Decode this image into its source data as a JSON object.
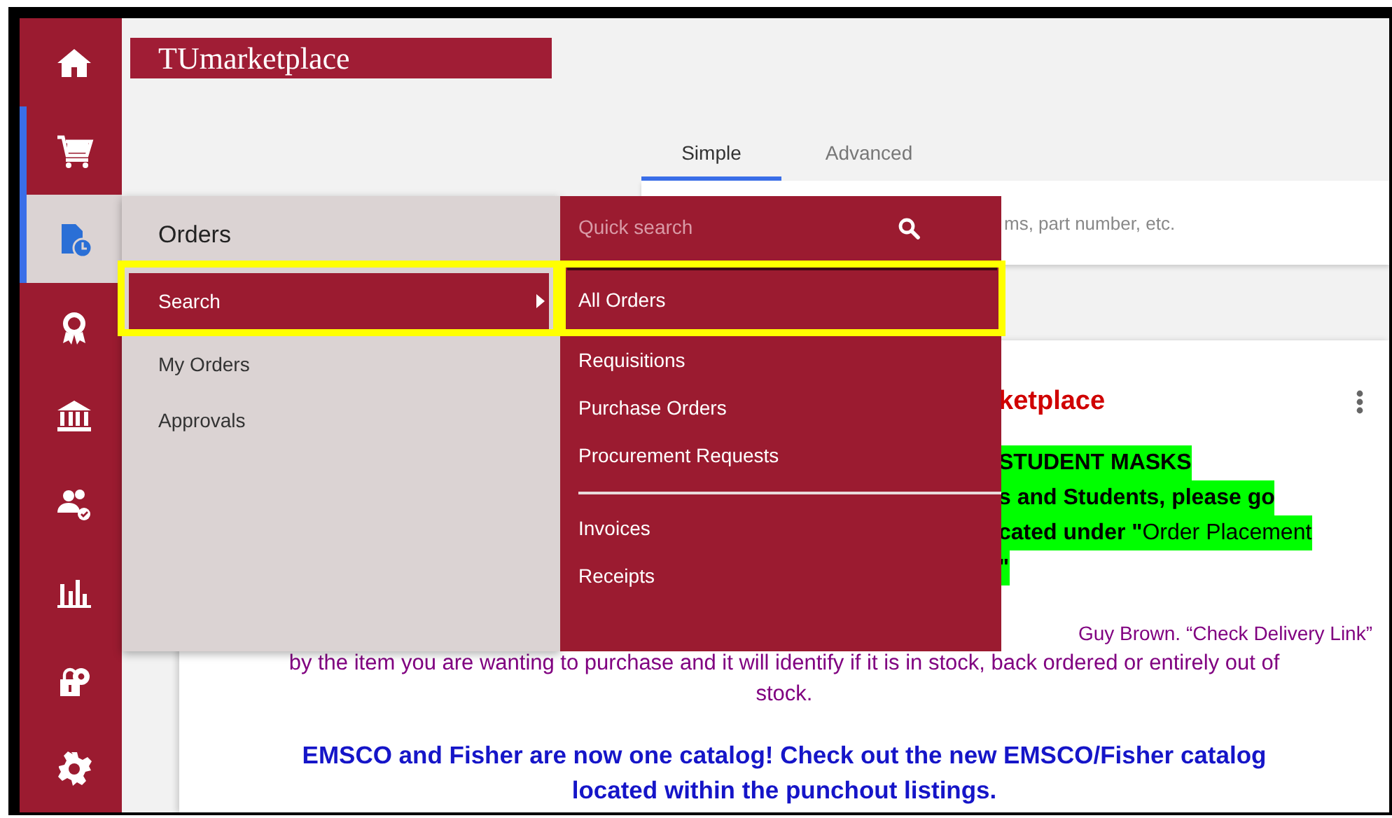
{
  "sidebar": {
    "items": [
      {
        "selected": false,
        "focused": false
      },
      {
        "selected": false,
        "focused": true
      },
      {
        "selected": true,
        "focused": true
      },
      {
        "selected": false,
        "focused": false
      },
      {
        "selected": false,
        "focused": false
      },
      {
        "selected": false,
        "focused": false
      },
      {
        "selected": false,
        "focused": false
      },
      {
        "selected": false,
        "focused": false
      },
      {
        "selected": false,
        "focused": false
      }
    ]
  },
  "logo": "TUmarketplace",
  "tabs": [
    {
      "label": "Simple",
      "selected": true
    },
    {
      "label": "Advanced",
      "selected": false
    }
  ],
  "search": {
    "placeholder": "ms, part number, etc."
  },
  "content": {
    "title": "ketplace",
    "highlight_lines": [
      "STUDENT MASKS",
      "s and Students, please go",
      "**cated under \"**Order Placement",
      "\""
    ],
    "note_fragment": "Guy Brown.  “Check Delivery Link”",
    "note": "by the item you are wanting to purchase and it will identify if it is in stock, back ordered or entirely out of stock.",
    "announcement": "EMSCO and Fisher are now one catalog!  Check out the new EMSCO/Fisher catalog located within the punchout listings."
  },
  "orders_menu": {
    "title": "Orders",
    "items": [
      {
        "label": "Search",
        "selected": true,
        "submenu": true
      },
      {
        "label": "My Orders",
        "selected": false,
        "submenu": false
      },
      {
        "label": "Approvals",
        "selected": false,
        "submenu": false
      }
    ]
  },
  "search_menu": {
    "placeholder": "Quick search",
    "groups": [
      [
        {
          "label": "All Orders",
          "selected": true
        },
        {
          "label": "Requisitions",
          "selected": false
        },
        {
          "label": "Purchase Orders",
          "selected": false
        },
        {
          "label": "Procurement Requests",
          "selected": false
        }
      ],
      [
        {
          "label": "Invoices",
          "selected": false
        },
        {
          "label": "Receipts",
          "selected": false
        }
      ]
    ]
  },
  "annotations": [
    {
      "kind": "frame"
    },
    {
      "kind": "frame"
    }
  ]
}
